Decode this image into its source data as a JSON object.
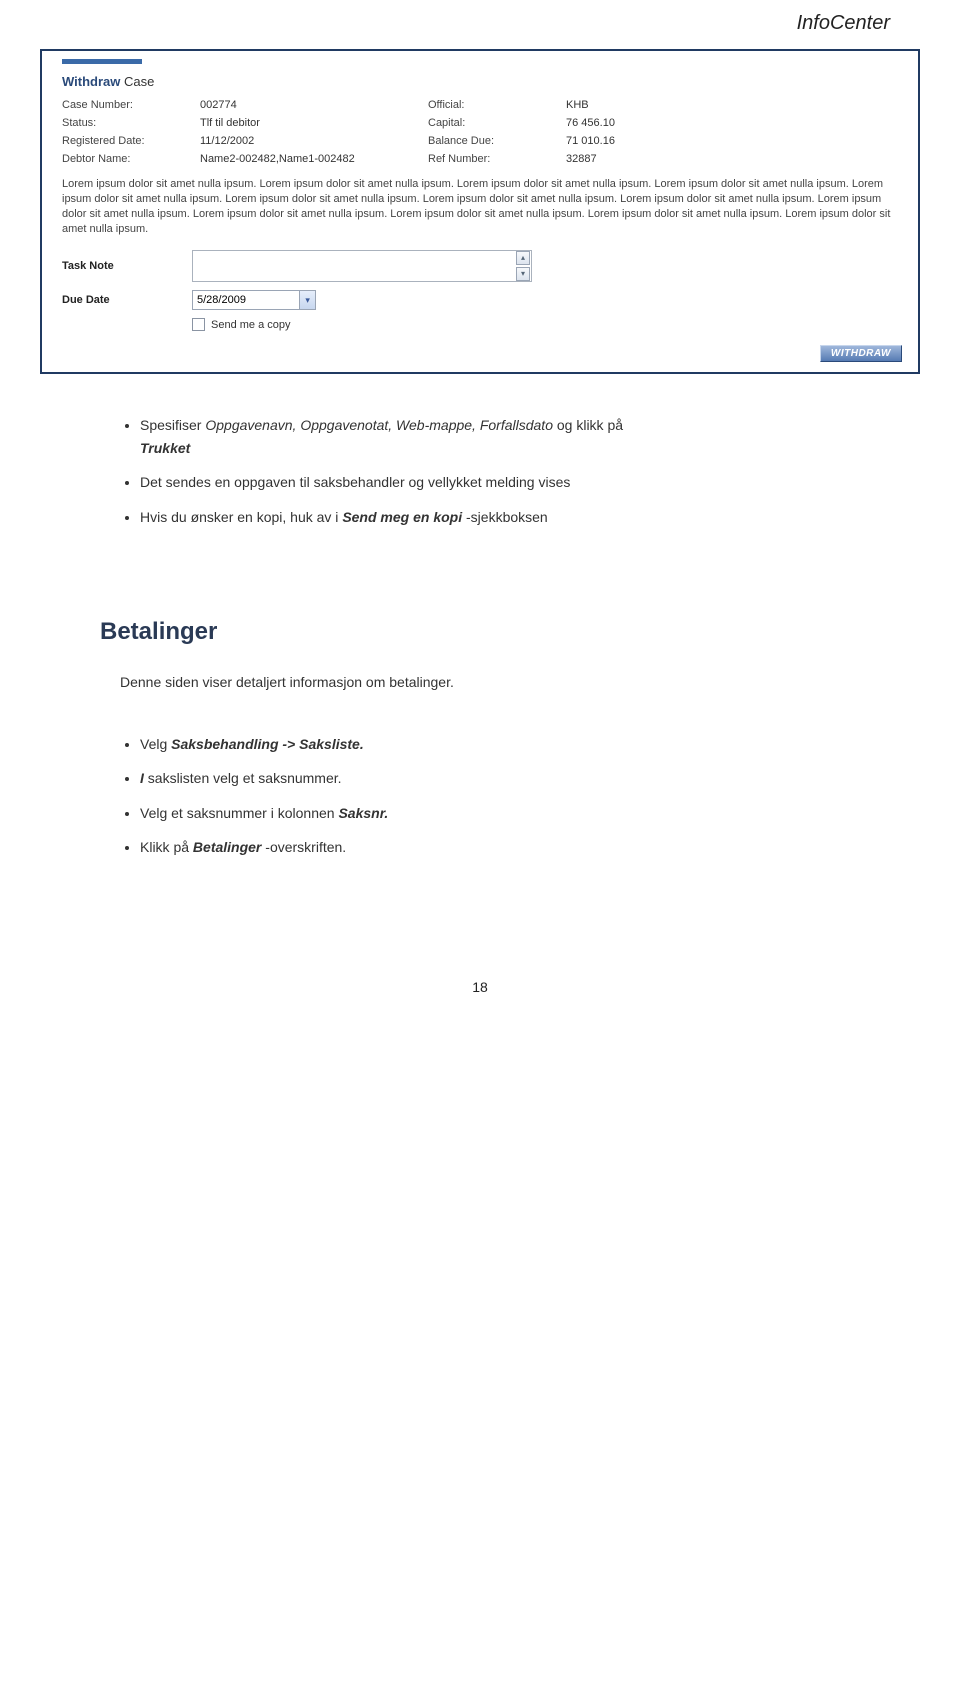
{
  "header": "InfoCenter",
  "panel": {
    "title_bold": "Withdraw",
    "title_rest": "Case",
    "fields": {
      "caseNumber_label": "Case Number:",
      "caseNumber_value": "002774",
      "official_label": "Official:",
      "official_value": "KHB",
      "status_label": "Status:",
      "status_value": "Tlf til debitor",
      "capital_label": "Capital:",
      "capital_value": "76 456.10",
      "regDate_label": "Registered Date:",
      "regDate_value": "11/12/2002",
      "balance_label": "Balance Due:",
      "balance_value": "71 010.16",
      "debtor_label": "Debtor Name:",
      "debtor_value": "Name2-002482,Name1-002482",
      "ref_label": "Ref Number:",
      "ref_value": "32887"
    },
    "lorem": "Lorem ipsum dolor sit amet nulla ipsum. Lorem ipsum dolor sit amet nulla ipsum. Lorem ipsum dolor sit amet nulla ipsum. Lorem ipsum dolor sit amet nulla ipsum. Lorem ipsum dolor sit amet nulla ipsum. Lorem ipsum dolor sit amet nulla ipsum. Lorem ipsum dolor sit amet nulla ipsum. Lorem ipsum dolor sit amet nulla ipsum. Lorem ipsum dolor sit amet nulla ipsum. Lorem ipsum dolor sit amet nulla ipsum. Lorem ipsum dolor sit amet nulla ipsum. Lorem ipsum dolor sit amet nulla ipsum. Lorem ipsum dolor sit amet nulla ipsum.",
    "taskNote_label": "Task Note",
    "dueDate_label": "Due Date",
    "dueDate_value": "5/28/2009",
    "sendCopy_label": "Send me a copy",
    "withdraw_button": "WITHDRAW"
  },
  "bullets1": {
    "b1_pre": "Spesifiser ",
    "b1_ital": "Oppgavenavn, Oppgavenotat, Web-mappe, Forfallsdato",
    "b1_mid": " og klikk på",
    "b1_bold": "Trukket",
    "b2": "Det sendes en oppgaven til saksbehandler og vellykket melding vises",
    "b3_pre": "Hvis du ønsker en kopi, huk av i ",
    "b3_ital": "Send meg en kopi",
    "b3_post": "-sjekkboksen"
  },
  "section": {
    "title": "Betalinger",
    "intro": "Denne siden viser detaljert informasjon om betalinger."
  },
  "bullets2": {
    "b1_pre": "Velg ",
    "b1_ital": "Saksbehandling -> Saksliste.",
    "b2_ital": "I",
    "b2_rest": " sakslisten velg et saksnummer.",
    "b3_pre": "Velg et saksnummer i kolonnen ",
    "b3_ital": "Saksnr.",
    "b4_pre": "Klikk på ",
    "b4_ital": "Betalinger",
    "b4_post": "-overskriften."
  },
  "pageNumber": "18"
}
